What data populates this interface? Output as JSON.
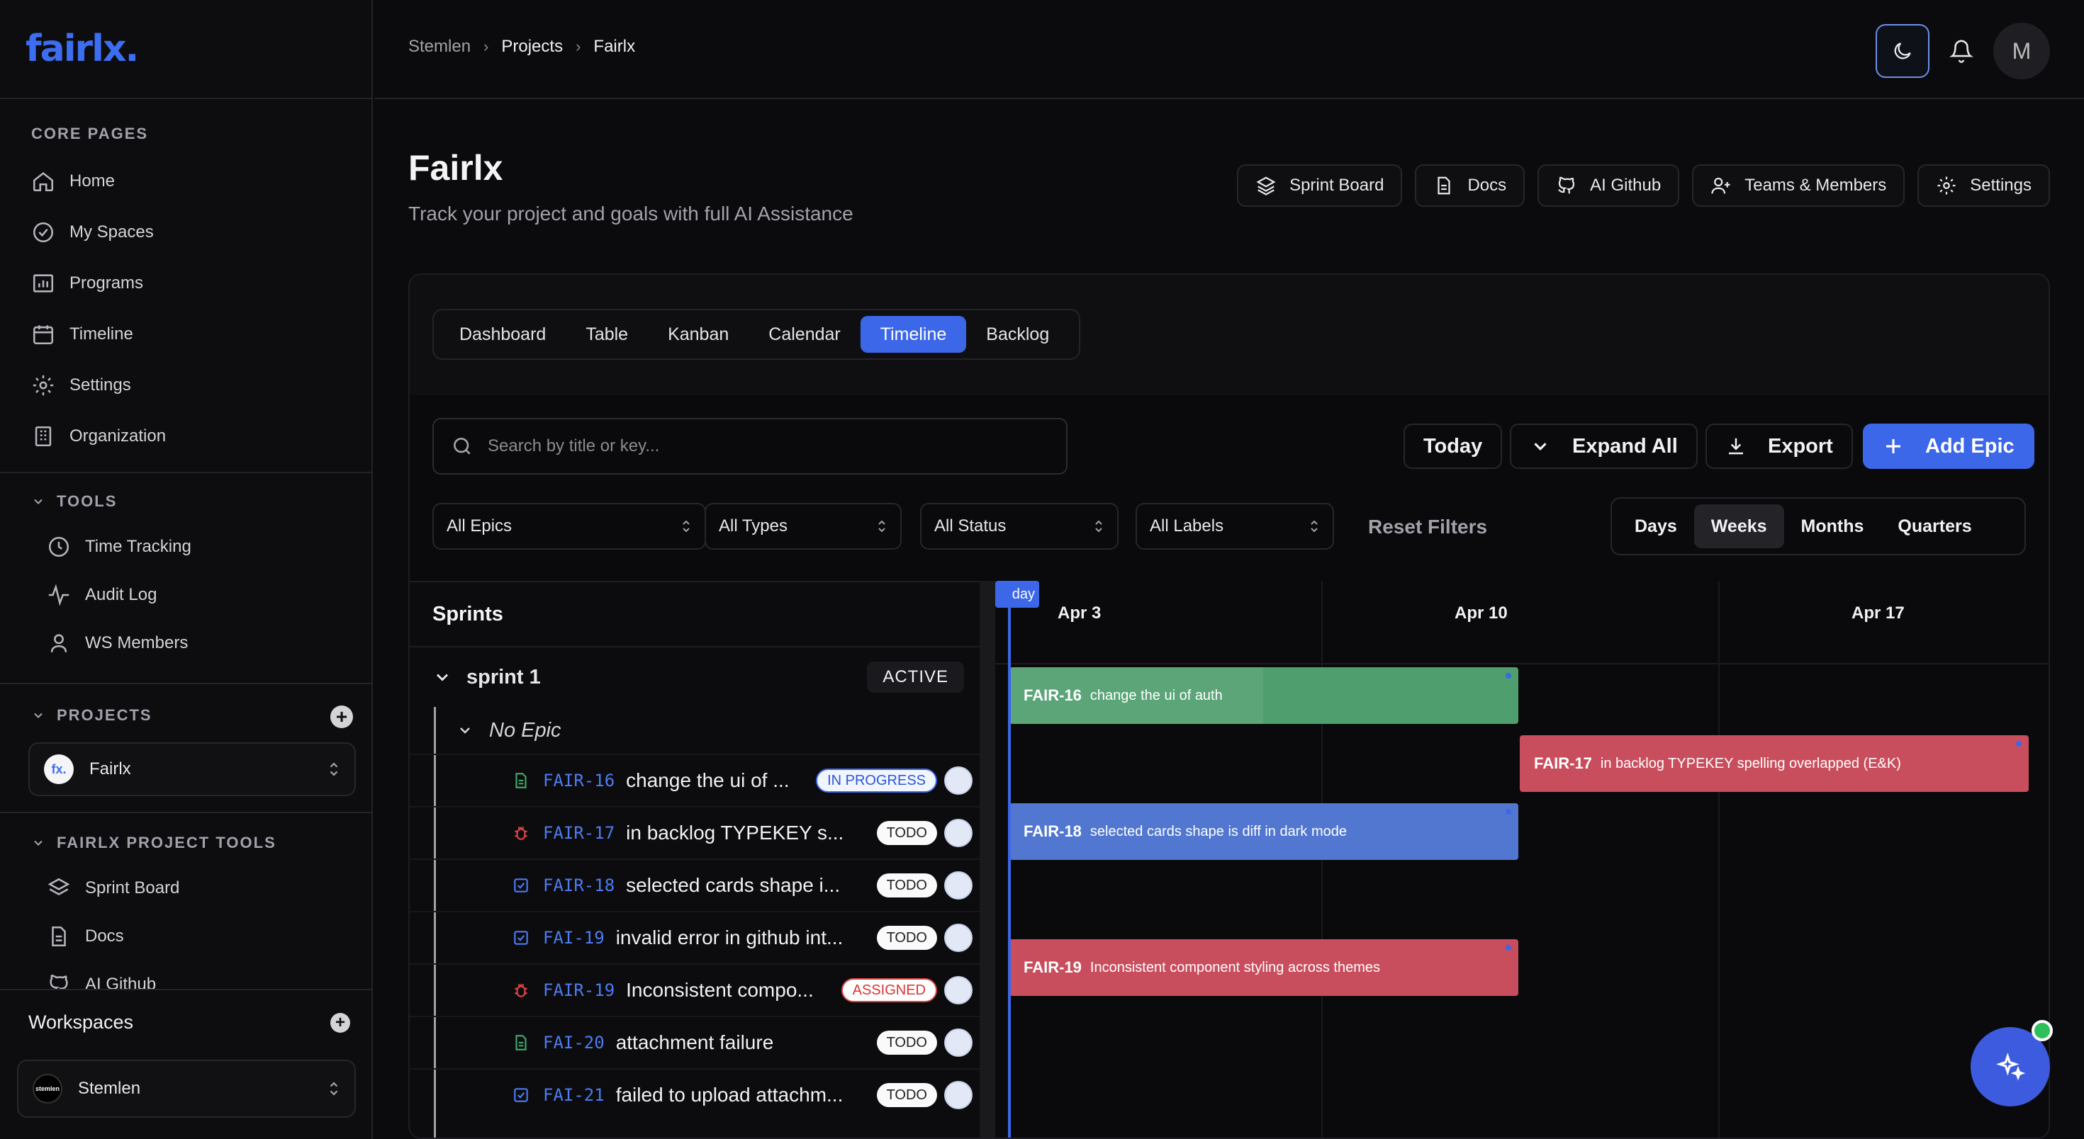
{
  "app": {
    "logo": "fairlx."
  },
  "sidebar": {
    "core_title": "CORE PAGES",
    "core_items": [
      {
        "label": "Home",
        "icon": "home-icon"
      },
      {
        "label": "My Spaces",
        "icon": "check-circle-icon"
      },
      {
        "label": "Programs",
        "icon": "chart-icon"
      },
      {
        "label": "Timeline",
        "icon": "calendar-icon"
      },
      {
        "label": "Settings",
        "icon": "gear-icon"
      },
      {
        "label": "Organization",
        "icon": "building-icon"
      }
    ],
    "tools_title": "TOOLS",
    "tools_items": [
      {
        "label": "Time Tracking",
        "icon": "clock-icon"
      },
      {
        "label": "Audit Log",
        "icon": "activity-icon"
      },
      {
        "label": "WS Members",
        "icon": "user-icon"
      }
    ],
    "projects_title": "PROJECTS",
    "project_selected": "Fairlx",
    "project_badge": "fx.",
    "project_tools_title": "FAIRLX PROJECT TOOLS",
    "project_tools_items": [
      {
        "label": "Sprint Board",
        "icon": "layers-icon"
      },
      {
        "label": "Docs",
        "icon": "doc-icon"
      },
      {
        "label": "AI Github",
        "icon": "github-icon"
      }
    ],
    "workspaces_title": "Workspaces",
    "workspace_selected": "Stemlen"
  },
  "breadcrumb": [
    "Stemlen",
    "Projects",
    "Fairlx"
  ],
  "user_avatar": "M",
  "header": {
    "title": "Fairlx",
    "subtitle": "Track your project and goals with full AI Assistance",
    "actions": [
      "Sprint Board",
      "Docs",
      "AI Github",
      "Teams & Members",
      "Settings"
    ]
  },
  "view_tabs": [
    "Dashboard",
    "Table",
    "Kanban",
    "Calendar",
    "Timeline",
    "Backlog"
  ],
  "active_view": "Timeline",
  "toolbar": {
    "search_placeholder": "Search by title or key...",
    "today": "Today",
    "expand_all": "Expand All",
    "export": "Export",
    "add_epic": "Add Epic",
    "filters": [
      "All Epics",
      "All Types",
      "All Status",
      "All Labels"
    ],
    "reset": "Reset Filters",
    "scales": [
      "Days",
      "Weeks",
      "Months",
      "Quarters"
    ],
    "active_scale": "Weeks"
  },
  "sprints": {
    "header": "Sprints",
    "sprint_name": "sprint 1",
    "sprint_status": "ACTIVE",
    "group": "No Epic",
    "tasks": [
      {
        "key": "FAIR-16",
        "title": "change the ui of ...",
        "status": "IN PROGRESS",
        "type": "story"
      },
      {
        "key": "FAIR-17",
        "title": "in backlog TYPEKEY s...",
        "status": "TODO",
        "type": "bug"
      },
      {
        "key": "FAIR-18",
        "title": "selected cards shape i...",
        "status": "TODO",
        "type": "task"
      },
      {
        "key": "FAI-19",
        "title": "invalid error in github int...",
        "status": "TODO",
        "type": "task"
      },
      {
        "key": "FAIR-19",
        "title": "Inconsistent compo...",
        "status": "ASSIGNED",
        "type": "bug"
      },
      {
        "key": "FAI-20",
        "title": "attachment failure",
        "status": "TODO",
        "type": "story"
      },
      {
        "key": "FAI-21",
        "title": "failed to upload attachm...",
        "status": "TODO",
        "type": "task"
      }
    ]
  },
  "timeline": {
    "today_label": "Today",
    "weeks": [
      "Apr 3",
      "Apr 10",
      "Apr 17"
    ],
    "bars": [
      {
        "key": "FAIR-16",
        "text": "change the ui of auth",
        "color": "#4e9e6e",
        "progress": 0.5
      },
      {
        "key": "FAIR-17",
        "text": "in backlog TYPEKEY spelling overlapped (E&K)",
        "color": "#c94e5d"
      },
      {
        "key": "FAIR-18",
        "text": "selected cards shape is diff in dark mode",
        "color": "#5177d1"
      },
      {
        "key": "FAIR-19",
        "text": "Inconsistent component styling across themes",
        "color": "#c94e5d"
      }
    ]
  }
}
